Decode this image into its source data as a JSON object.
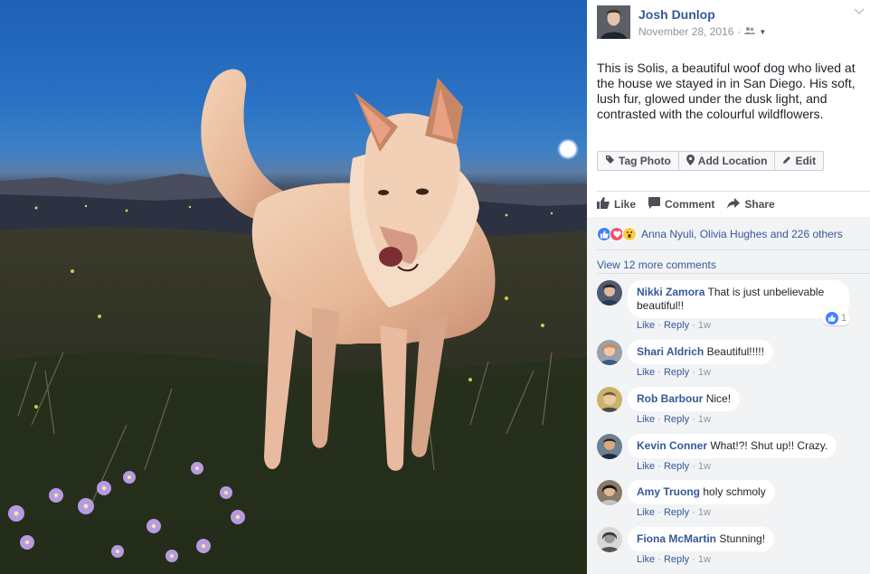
{
  "post": {
    "author": "Josh Dunlop",
    "date": "November 28, 2016",
    "audience_icon": "friends-icon",
    "caption": "This is Solis, a beautiful woof dog who lived at the house we stayed in in San Diego. His soft, lush fur, glowed under the dusk light, and contrasted with the colourful wildflowers."
  },
  "photo_actions": {
    "tag": "Tag Photo",
    "location": "Add Location",
    "edit": "Edit"
  },
  "action_bar": {
    "like": "Like",
    "comment": "Comment",
    "share": "Share"
  },
  "reactions": {
    "names": "Anna Nyuli, Olivia Hughes and 226 others",
    "icons": [
      "like-icon",
      "love-icon",
      "wow-icon"
    ]
  },
  "view_more": "View 12 more comments",
  "comments": [
    {
      "name": "Nikki Zamora",
      "text": "That is just unbelievable beautiful!!",
      "like": "Like",
      "reply": "Reply",
      "time": "1w",
      "reaction_count": "1"
    },
    {
      "name": "Shari Aldrich",
      "text": "Beautiful!!!!!",
      "like": "Like",
      "reply": "Reply",
      "time": "1w"
    },
    {
      "name": "Rob Barbour",
      "text": "Nice!",
      "like": "Like",
      "reply": "Reply",
      "time": "1w"
    },
    {
      "name": "Kevin Conner",
      "text": "What!?! Shut up!! Crazy.",
      "like": "Like",
      "reply": "Reply",
      "time": "1w"
    },
    {
      "name": "Amy Truong",
      "text": "holy schmoly",
      "like": "Like",
      "reply": "Reply",
      "time": "1w"
    },
    {
      "name": "Fiona McMartin",
      "text": "Stunning!",
      "like": "Like",
      "reply": "Reply",
      "time": "1w"
    }
  ],
  "colors": {
    "link": "#365899",
    "meta": "#90949c",
    "panel_bg": "#f2f3f5",
    "like_blue": "#4080ff",
    "love_red": "#f25268"
  }
}
